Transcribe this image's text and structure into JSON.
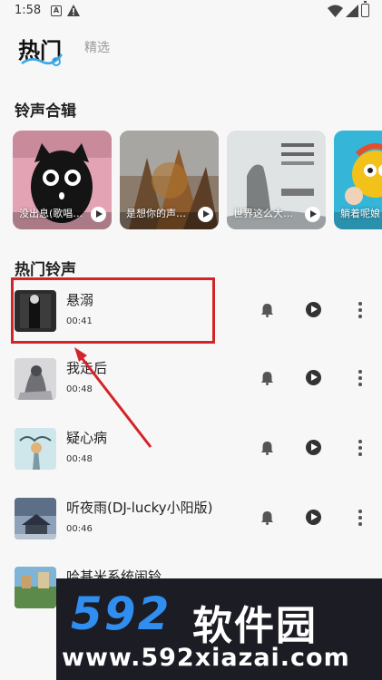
{
  "status_bar": {
    "time": "1:58"
  },
  "tabs": {
    "hot": "热门",
    "featured": "精选"
  },
  "sections": {
    "collections": "铃声合辑",
    "hot_ringtones": "热门铃声"
  },
  "collections": [
    {
      "title": "没出息(歌唱…"
    },
    {
      "title": "是想你的声…"
    },
    {
      "title": "世界这么大…"
    },
    {
      "title": "躺着呢娘"
    }
  ],
  "songs": [
    {
      "title": "悬溺",
      "duration": "00:41"
    },
    {
      "title": "我走后",
      "duration": "00:48"
    },
    {
      "title": "疑心病",
      "duration": "00:48"
    },
    {
      "title": "听夜雨(DJ-lucky小阳版)",
      "duration": "00:46"
    },
    {
      "title": "哈基米系统闹铃",
      "duration": ""
    }
  ],
  "watermark": {
    "logo": "592",
    "brand": "软件园",
    "url": "www.592xiazai.com"
  },
  "colors": {
    "highlight": "#d3242a",
    "watermark_blue": "#2f8ef0",
    "watermark_bg": "#1c1c24"
  }
}
